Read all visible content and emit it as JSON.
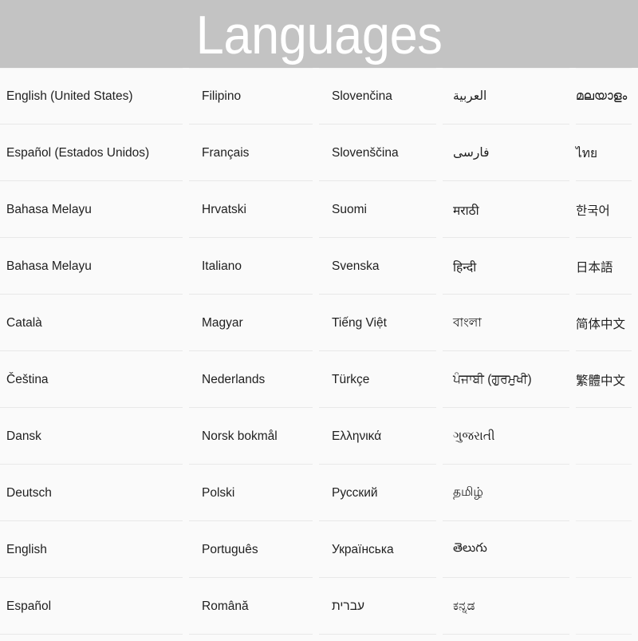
{
  "header": {
    "title": "Languages",
    "background_color": "#c3c3c3",
    "title_color": "#ffffff"
  },
  "theme": {
    "page_background": "#fafafa",
    "row_background": "#fafafa",
    "separator_color": "#e8e8e8",
    "text_color": "#1f1f1f"
  },
  "grid": {
    "columns": 5,
    "rows": 10,
    "items": [
      [
        "English (United States)",
        "Filipino",
        "Slovenčina",
        "العربية",
        "മലയാളം"
      ],
      [
        "Español (Estados Unidos)",
        "Français",
        "Slovenščina",
        "فارسی",
        "ไทย"
      ],
      [
        "Bahasa Melayu",
        "Hrvatski",
        "Suomi",
        "मराठी",
        "한국어"
      ],
      [
        "Bahasa Melayu",
        "Italiano",
        "Svenska",
        "हिन्दी",
        "日本語"
      ],
      [
        "Català",
        "Magyar",
        "Tiếng Việt",
        "বাংলা",
        "简体中文"
      ],
      [
        "Čeština",
        "Nederlands",
        "Türkçe",
        "ਪੰਜਾਬੀ (ਗੁਰਮੁਖੀ)",
        "繁體中文"
      ],
      [
        "Dansk",
        "Norsk bokmål",
        "Ελληνικά",
        "ગુજરાતી",
        ""
      ],
      [
        "Deutsch",
        "Polski",
        "Русский",
        "தமிழ்",
        ""
      ],
      [
        "English",
        "Português",
        "Українська",
        "తెలుగు",
        ""
      ],
      [
        "Español",
        "Română",
        "עברית",
        "ಕನ್ನಡ",
        ""
      ]
    ]
  }
}
